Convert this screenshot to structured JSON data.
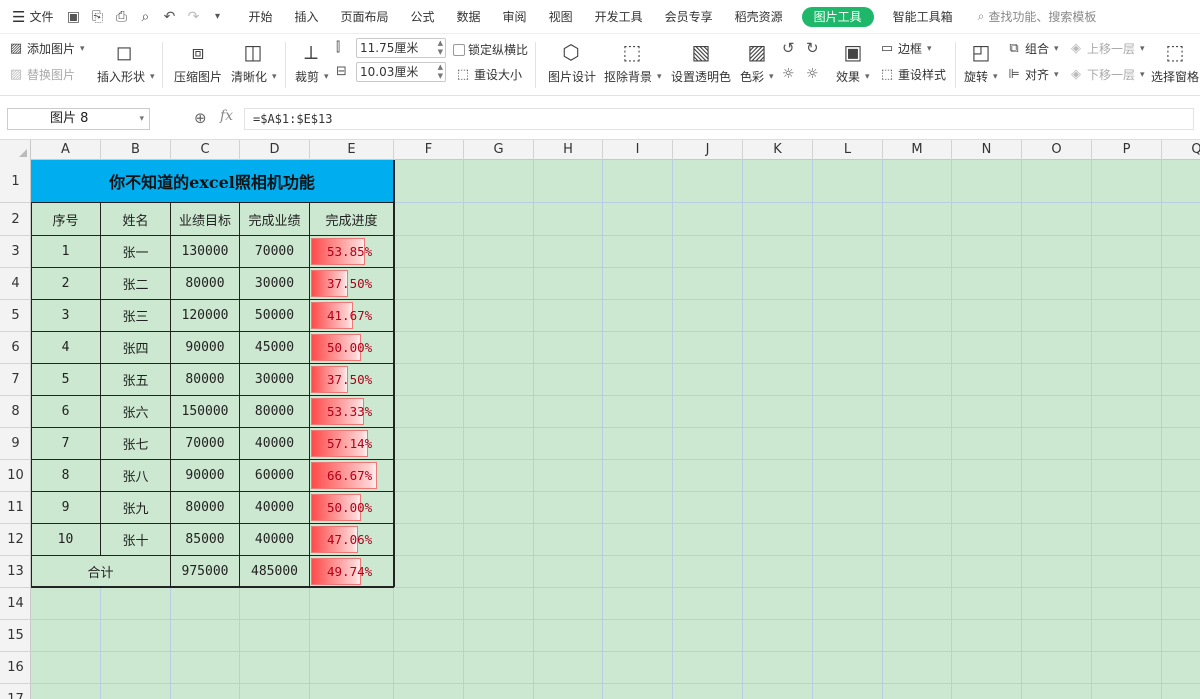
{
  "menubar": {
    "file_label": "文件",
    "tabs": [
      "开始",
      "插入",
      "页面布局",
      "公式",
      "数据",
      "审阅",
      "视图",
      "开发工具",
      "会员专享",
      "稻壳资源",
      "图片工具",
      "智能工具箱"
    ],
    "active_tab": "图片工具",
    "search_placeholder": "查找功能、搜索模板",
    "accent_color": "#1fb86a"
  },
  "ribbon": {
    "add_picture": "添加图片",
    "replace_picture": "替换图片",
    "insert_shape": "插入形状",
    "compress_picture": "压缩图片",
    "sharpen": "清晰化",
    "crop": "裁剪",
    "width_value": "11.75厘米",
    "height_value": "10.03厘米",
    "lock_ratio": "锁定纵横比",
    "reset_size": "重设大小",
    "picture_design": "图片设计",
    "remove_background": "抠除背景",
    "set_transparent": "设置透明色",
    "color": "色彩",
    "effects": "效果",
    "border": "边框",
    "reset_style": "重设样式",
    "rotate": "旋转",
    "group": "组合",
    "align": "对齐",
    "bring_forward": "上移一层",
    "send_backward": "下移一层",
    "select_pane": "选择窗格"
  },
  "formula_bar": {
    "name_box": "图片 8",
    "fx": "fx",
    "formula": "=$A$1:$E$13"
  },
  "columns": [
    "A",
    "B",
    "C",
    "D",
    "E",
    "F",
    "G",
    "H",
    "I",
    "J",
    "K",
    "L",
    "M",
    "N",
    "O",
    "P",
    "Q"
  ],
  "rows": [
    "1",
    "2",
    "3",
    "4",
    "5",
    "6",
    "7",
    "8",
    "9",
    "10",
    "11",
    "12",
    "13",
    "14",
    "15",
    "16",
    "17"
  ],
  "table": {
    "title": "你不知道的excel照相机功能",
    "title_bg": "#00aeef",
    "headers": [
      "序号",
      "姓名",
      "业绩目标",
      "完成业绩",
      "完成进度"
    ],
    "rows": [
      {
        "no": "1",
        "name": "张一",
        "target": "130000",
        "done": "70000",
        "progress": "53.85%",
        "pct": 53.85
      },
      {
        "no": "2",
        "name": "张二",
        "target": "80000",
        "done": "30000",
        "progress": "37.50%",
        "pct": 37.5
      },
      {
        "no": "3",
        "name": "张三",
        "target": "120000",
        "done": "50000",
        "progress": "41.67%",
        "pct": 41.67
      },
      {
        "no": "4",
        "name": "张四",
        "target": "90000",
        "done": "45000",
        "progress": "50.00%",
        "pct": 50.0
      },
      {
        "no": "5",
        "name": "张五",
        "target": "80000",
        "done": "30000",
        "progress": "37.50%",
        "pct": 37.5
      },
      {
        "no": "6",
        "name": "张六",
        "target": "150000",
        "done": "80000",
        "progress": "53.33%",
        "pct": 53.33
      },
      {
        "no": "7",
        "name": "张七",
        "target": "70000",
        "done": "40000",
        "progress": "57.14%",
        "pct": 57.14
      },
      {
        "no": "8",
        "name": "张八",
        "target": "90000",
        "done": "60000",
        "progress": "66.67%",
        "pct": 66.67
      },
      {
        "no": "9",
        "name": "张九",
        "target": "80000",
        "done": "40000",
        "progress": "50.00%",
        "pct": 50.0
      },
      {
        "no": "10",
        "name": "张十",
        "target": "85000",
        "done": "40000",
        "progress": "47.06%",
        "pct": 47.06
      }
    ],
    "total": {
      "label": "合计",
      "target": "975000",
      "done": "485000",
      "progress": "49.74%",
      "pct": 49.74
    }
  }
}
